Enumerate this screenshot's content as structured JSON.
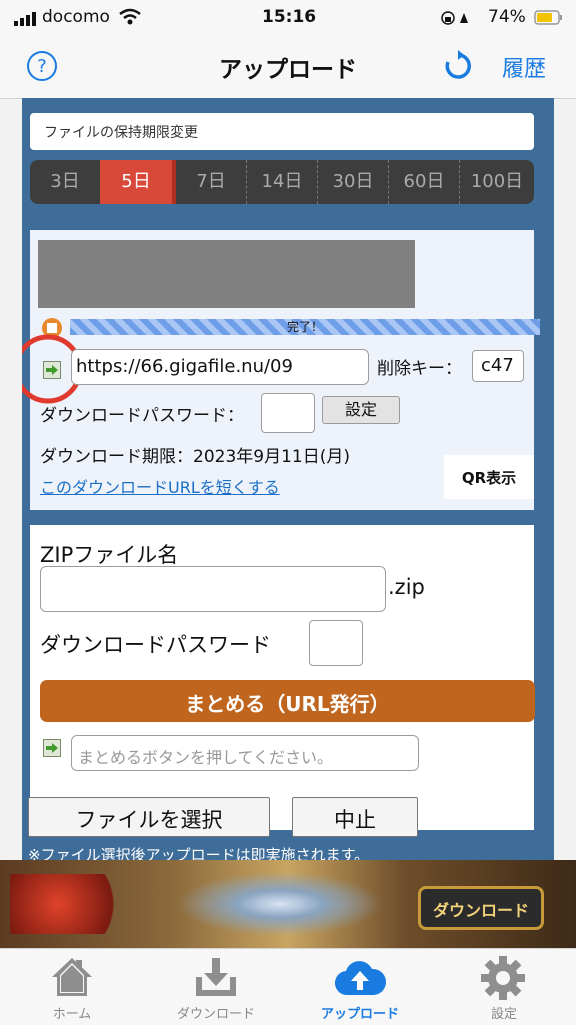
{
  "status": {
    "carrier": "docomo",
    "time": "15:16",
    "battery": "74%"
  },
  "nav": {
    "title": "アップロード",
    "history": "履歴"
  },
  "retention": {
    "title": "ファイルの保持期限変更",
    "options": [
      "3日",
      "5日",
      "7日",
      "14日",
      "30日",
      "60日",
      "100日"
    ],
    "selected": "5日"
  },
  "upload": {
    "progress_text": "完了！",
    "progress": 1.0,
    "url": "https://66.gigafile.nu/09",
    "delete_key_label": "削除キー：",
    "delete_key": "c47",
    "password_label": "ダウンロードパスワード：",
    "password_value": "",
    "set_button": "設定",
    "expiry": "ダウンロード期限：2023年9月11日(月)",
    "shorten_link": "このダウンロードURLを短くする",
    "qr_button": "QR表示"
  },
  "zip": {
    "name_label": "ZIPファイル名",
    "name_value": "",
    "ext": ".zip",
    "password_label": "ダウンロードパスワード",
    "password_value": "",
    "bundle_button": "まとめる（URL発行）",
    "result_placeholder": "まとめるボタンを押してください。"
  },
  "actions": {
    "select_file": "ファイルを選択",
    "cancel": "中止",
    "note": "※ファイル選択後アップロードは即実施されます。"
  },
  "ad": {
    "cta": "ダウンロード"
  },
  "tabbar": {
    "home": "ホーム",
    "download": "ダウンロード",
    "upload": "アップロード",
    "settings": "設定"
  },
  "colors": {
    "accent": "#1a7be0",
    "selected_tab": "#d9493a",
    "bundle_button": "#c0651d",
    "main_bg": "#3f6d9a",
    "annotation_circle": "#e03a2f"
  }
}
